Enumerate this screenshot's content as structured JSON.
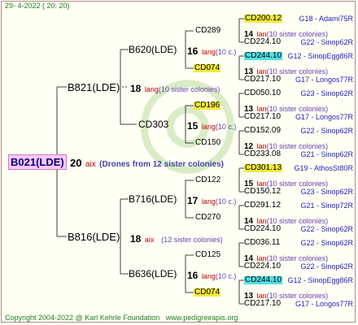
{
  "header": {
    "date": "29-  4-2022 ( 20: 20)"
  },
  "footer": {
    "copyright": "Copyright 2004-2022 @ Karl Kehrle Foundation",
    "url": "www.pedigreeapis.org"
  },
  "root": {
    "label": "B021(LDE)",
    "num": "20",
    "lang": "aix",
    "note": "(Drones from 12 sister colonies)"
  },
  "gen1": [
    {
      "label": "B821(LDE)",
      "num": "18",
      "lang": "lang",
      "note": "(10 sister colonies)"
    },
    {
      "label": "B816(LDE)",
      "num": "18",
      "lang": "aix",
      "note": "(12 sister colonies)"
    }
  ],
  "gen2": [
    {
      "label": "B620(LDE)",
      "num": "16",
      "lang": "lang",
      "note": "(10 c.)"
    },
    {
      "label": "CD303",
      "num": "15",
      "lang": "lang",
      "note": "(10 c.)"
    },
    {
      "label": "B716(LDE)",
      "num": "17",
      "lang": "lang",
      "note": "(10 c.)"
    },
    {
      "label": "B636(LDE)",
      "num": "16",
      "lang": "lang",
      "note": "(10 c.)"
    }
  ],
  "gen3": [
    {
      "label": "CD289"
    },
    {
      "label": "CD074"
    },
    {
      "label": "CD196"
    },
    {
      "label": "CD150"
    },
    {
      "label": "CD122"
    },
    {
      "label": "CD270"
    },
    {
      "label": "CD125"
    },
    {
      "label": "CD074"
    }
  ],
  "gen4": [
    {
      "top": "CD200.12",
      "top_hl": "yellow",
      "top_info": "G18 - Adami75R",
      "num": "14",
      "lang": "lan",
      "note": "(10 sister colonies)",
      "bot": "CD224.10",
      "bot_info": "G22 - Sinop62R"
    },
    {
      "top": "CD244.10",
      "top_hl": "cyan",
      "top_info": "G12 - SinopEgg86R",
      "num": "13",
      "lang": "lan",
      "note": "(10 sister colonies)",
      "bot": "CD217.10",
      "bot_info": "G17 - Longos77R"
    },
    {
      "top": "CD050.10",
      "top_hl": "",
      "top_info": "G23 - Sinop62R",
      "num": "13",
      "lang": "lan",
      "note": "(10 sister colonies)",
      "bot": "CD217.10",
      "bot_info": "G17 - Longos77R"
    },
    {
      "top": "CD152.09",
      "top_hl": "",
      "top_info": "G22 - Sinop62R",
      "num": "12",
      "lang": "lan",
      "note": "(10 sister colonies)",
      "bot": "CD233.08",
      "bot_info": "G21 - Sinop62R"
    },
    {
      "top": "CD301.13",
      "top_hl": "yellow",
      "top_info": "G19 - AthosSt80R",
      "num": "15",
      "lang": "lan",
      "note": "(10 sister colonies)",
      "bot": "CD150.12",
      "bot_info": "G23 - Sinop62R"
    },
    {
      "top": "CD291.12",
      "top_hl": "",
      "top_info": "G21 - Sinop72R",
      "num": "14",
      "lang": "lan",
      "note": "(10 sister colonies)",
      "bot": "CD224.10",
      "bot_info": "G22 - Sinop62R"
    },
    {
      "top": "CD036.11",
      "top_hl": "",
      "top_info": "G22 - Sinop62R",
      "num": "14",
      "lang": "lan",
      "note": "(10 sister colonies)",
      "bot": "CD224.10",
      "bot_info": "G22 - Sinop62R"
    },
    {
      "top": "CD244.10",
      "top_hl": "cyan",
      "top_info": "G12 - SinopEgg86R",
      "num": "13",
      "lang": "lan",
      "note": "(10 sister colonies)",
      "bot": "CD217.10",
      "bot_info": "G17 - Longos77R"
    }
  ]
}
